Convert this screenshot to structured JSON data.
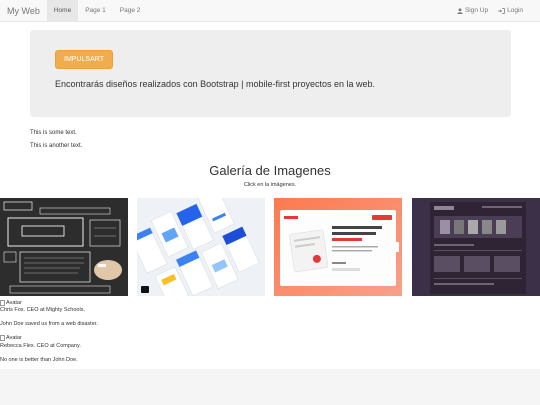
{
  "navbar": {
    "brand": "My Web",
    "items": [
      {
        "label": "Home",
        "active": true
      },
      {
        "label": "Page 1",
        "active": false
      },
      {
        "label": "Page 2",
        "active": false
      }
    ],
    "right": [
      {
        "label": "Sign Up",
        "icon": "user-icon"
      },
      {
        "label": "Login",
        "icon": "login-icon"
      }
    ]
  },
  "jumbotron": {
    "button_label": "IMPULSART",
    "lead": "Encontrarás diseños realizados con Bootstrap | mobile-first proyectos en la web."
  },
  "content": {
    "text1": "This is some text.",
    "text2": "This is another text."
  },
  "gallery": {
    "title": "Galería de Imagenes",
    "subtitle": "Click en la imágenes."
  },
  "testimonials": [
    {
      "avatar_alt": "Avatar",
      "name": "Chris Fox. CEO at Mighty Schools.",
      "quote": "John Doe saved us from a web disaster."
    },
    {
      "avatar_alt": "Avatar",
      "name": "Rebecca Flex. CEO at Company.",
      "quote": "No one is better than John Doe."
    }
  ],
  "colors": {
    "button": "#f0ad4e",
    "navbar_bg": "#f8f8f8",
    "jumbotron_bg": "#eeeeee"
  }
}
